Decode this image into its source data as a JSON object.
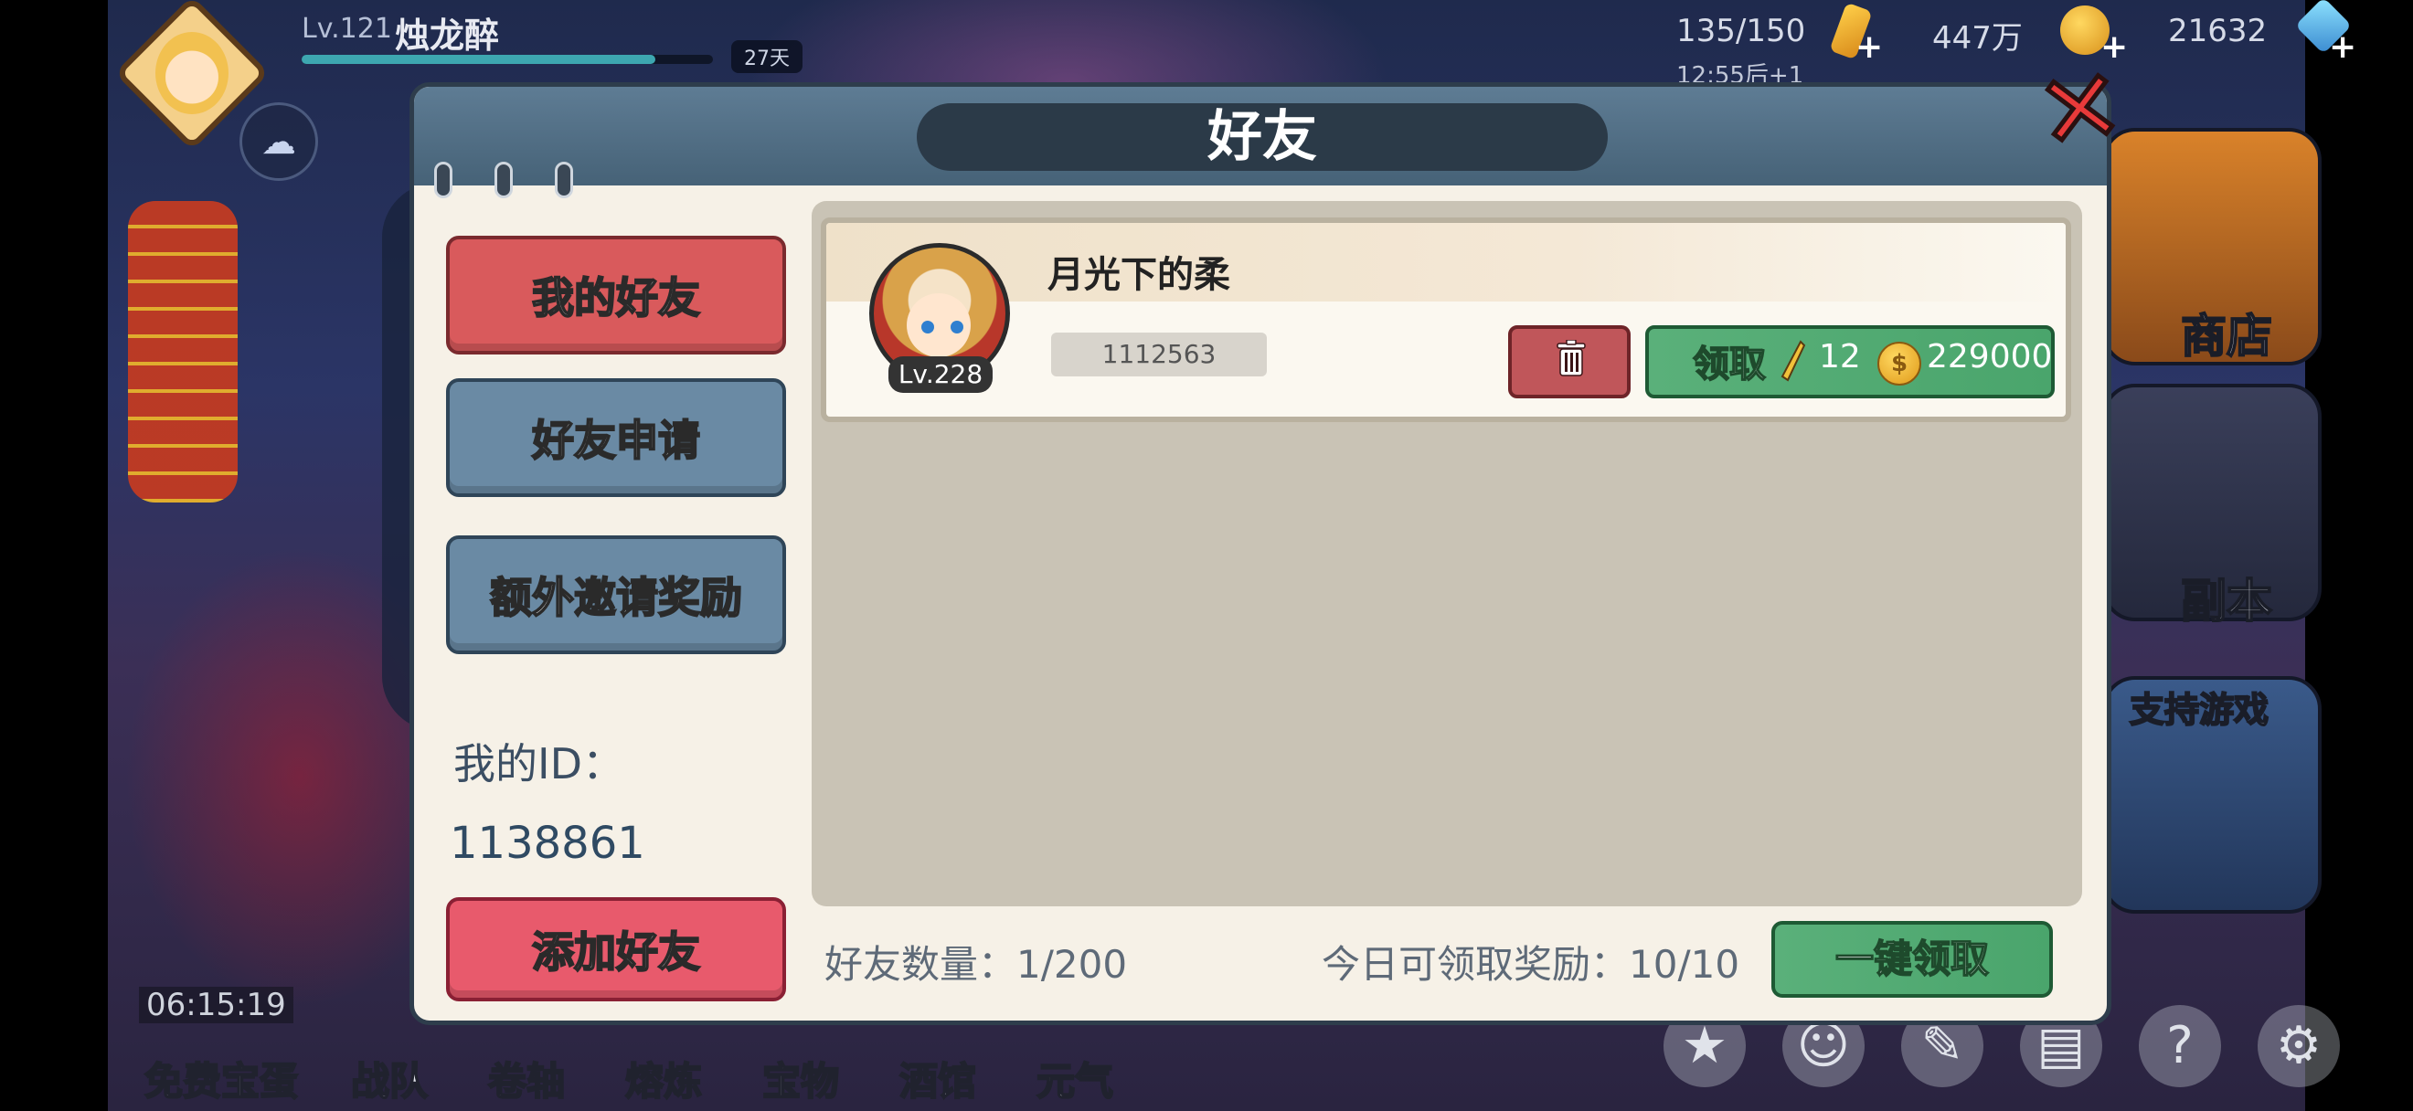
{
  "hud": {
    "level": "Lv.121",
    "player_name": "烛龙醉",
    "exp_fraction": 0.86,
    "days": "27天",
    "stamina": "135/150",
    "stamina_timer": "12:55后+1",
    "gold": "447万",
    "gems": "21632"
  },
  "side_menu": {
    "shop": "商店",
    "dungeon": "副本",
    "support": "支持游戏"
  },
  "bottom_nav": {
    "timer": "06:15:19",
    "items": [
      "免费宝蛋",
      "战队",
      "卷轴",
      "熔炼",
      "宝物",
      "酒馆",
      "元气"
    ]
  },
  "dialog": {
    "title": "好友",
    "tabs": {
      "my_friends": "我的好友",
      "friend_requests": "好友申请",
      "invite_rewards": "额外邀请奖励"
    },
    "my_id_label": "我的ID：",
    "my_id_value": "1138861",
    "add_friend": "添加好友",
    "friend": {
      "name": "月光下的柔",
      "level": "Lv.228",
      "id": "1112563",
      "claim_label": "领取",
      "reward_stamina": "12",
      "reward_gold": "229000"
    },
    "friend_count": "好友数量：1/200",
    "today_rewards": "今日可领取奖励：10/10",
    "claim_all": "一键领取"
  },
  "colors": {
    "accent_red": "#d95a5c",
    "accent_blue": "#6a8aa4",
    "accent_green": "#4aa56c",
    "panel_bg": "#f6f1e7"
  }
}
